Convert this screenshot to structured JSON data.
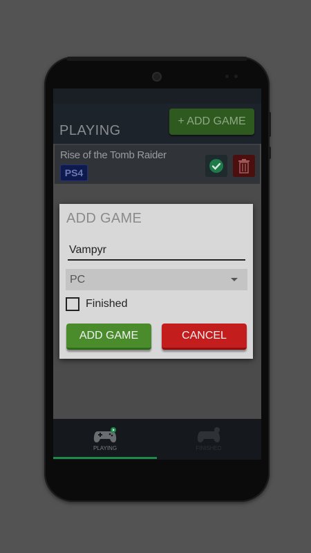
{
  "header": {
    "title": "PLAYING",
    "add_button_label": "+ ADD GAME"
  },
  "game": {
    "title": "Rise of the Tomb Raider",
    "platform": "PS4"
  },
  "dialog": {
    "title": "ADD GAME",
    "name_value": "Vampyr",
    "platform_selected": "PC",
    "finished_label": "Finished",
    "add_label": "ADD GAME",
    "cancel_label": "CANCEL"
  },
  "nav": {
    "tabs": [
      {
        "label": "PLAYING",
        "icon": "gamepad-play-icon"
      },
      {
        "label": "FINISHED",
        "icon": "gamepad-check-icon"
      }
    ]
  },
  "colors": {
    "accent_green": "#4a8c2c",
    "cancel_red": "#c41d1d",
    "tab_indicator": "#1e8a4a"
  }
}
